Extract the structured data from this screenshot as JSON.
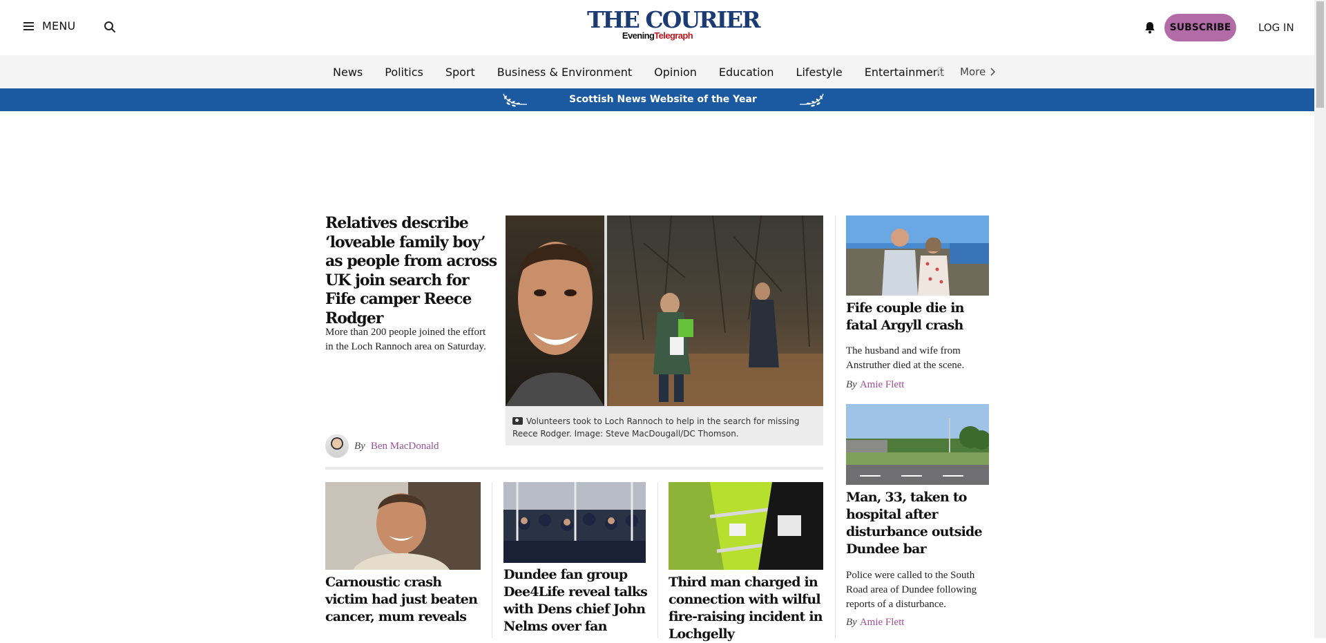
{
  "header": {
    "menu_label": "MENU",
    "logo_main": "THE COURIER",
    "logo_sub_evening": "Evening",
    "logo_sub_telegraph": "Telegraph",
    "subscribe_label": "SUBSCRIBE",
    "login_label": "LOG IN",
    "brand_color": "#1a3b73",
    "accent_color": "#b36ba8"
  },
  "nav": {
    "items": [
      "News",
      "Politics",
      "Sport",
      "Business & Environment",
      "Opinion",
      "Education",
      "Lifestyle",
      "Entertainment"
    ],
    "cut_item": "C",
    "more_label": "More"
  },
  "award": {
    "text": "Scottish News Website of the Year",
    "color": "#1b5aa0"
  },
  "lead": {
    "headline": "Relatives describe ‘loveable family boy’ as people from across UK join search for Fife camper Reece Rodger",
    "standfirst": "More than 200 people joined the effort in the Loch Rannoch area on Saturday.",
    "by": "By",
    "author": "Ben MacDonald",
    "caption": "Volunteers took to Loch Rannoch to help in the search for missing Reece Rodger. Image: Steve MacDougall/DC Thomson."
  },
  "cards": [
    {
      "headline": "Carnoustic crash victim had just beaten cancer, mum reveals"
    },
    {
      "headline": "Dundee fan group Dee4Life reveal talks with Dens chief John Nelms over fan"
    },
    {
      "headline": "Third man charged in connection with wilful fire-raising incident in Lochgelly"
    }
  ],
  "sidebar": [
    {
      "headline": "Fife couple die in fatal Argyll crash",
      "standfirst": "The husband and wife from Anstruther died at the scene.",
      "by": "By",
      "author": "Amie Flett"
    },
    {
      "headline": "Man, 33, taken to hospital after disturbance outside Dundee bar",
      "standfirst": "Police were called to the South Road area of Dundee following reports of a disturbance.",
      "by": "By",
      "author": "Amie Flett"
    }
  ]
}
